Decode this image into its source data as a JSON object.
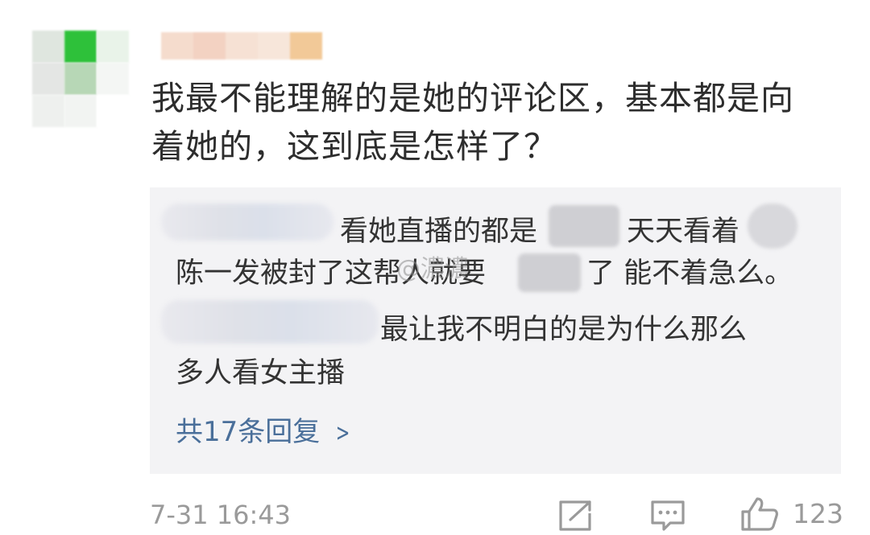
{
  "comment": {
    "text_line1": "我最不能理解的是她的评论区，基本都是向",
    "text_line2": "着她的，这到底是怎样了？",
    "timestamp": "7-31 16:43",
    "like_count": "123"
  },
  "replies": [
    {
      "line1_a": "看她直播的都是",
      "line1_b": "天天看着",
      "line2_a": "陈一发被封了这帮人就要",
      "line2_b": "了 能不着急么。"
    },
    {
      "line1": "最让我不明白的是为什么那么",
      "line2": "多人看女主播"
    }
  ],
  "watermark": "@濃濃",
  "more_replies_label": "共17条回复",
  "icons": {
    "share": "share-icon",
    "comment": "comment-icon",
    "like": "thumbs-up-icon",
    "chevron": "chevron-right-icon"
  },
  "colors": {
    "link": "#4a6f9a",
    "meta": "#9a9a9a",
    "reply_bg": "#f3f3f5"
  }
}
